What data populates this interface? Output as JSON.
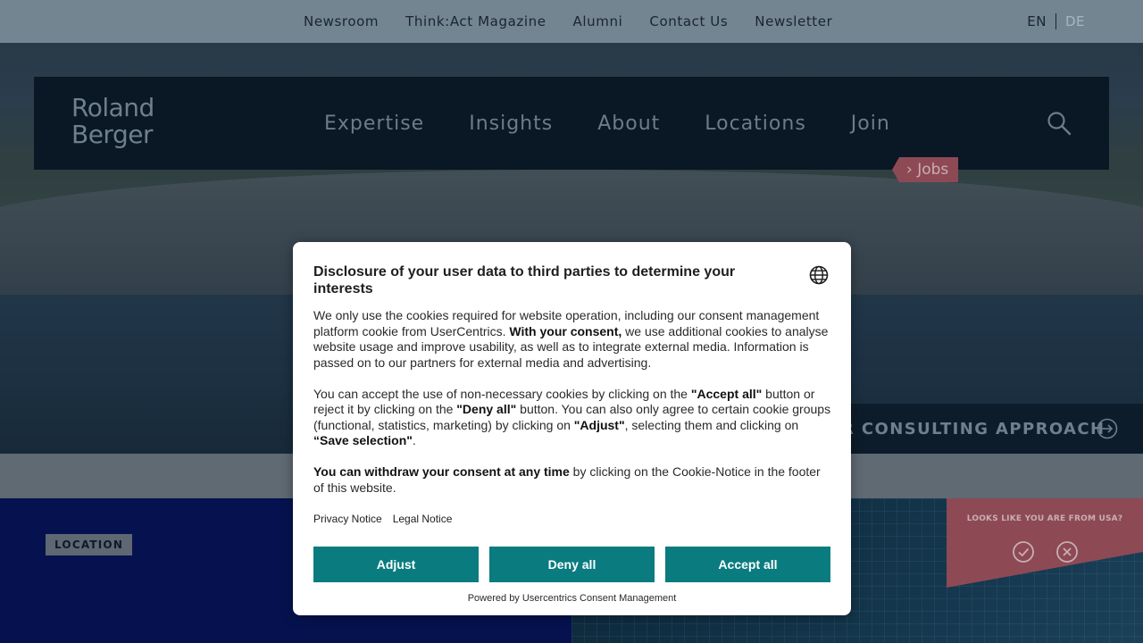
{
  "topbar": {
    "links": [
      "Newsroom",
      "Think:Act Magazine",
      "Alumni",
      "Contact Us",
      "Newsletter"
    ],
    "lang_active": "EN",
    "lang_inactive": "DE"
  },
  "header": {
    "logo_line1": "Roland",
    "logo_line2": "Berger",
    "nav": [
      "Expertise",
      "Insights",
      "About",
      "Locations",
      "Join"
    ],
    "search_icon": "search-icon",
    "jobs_tag": "› Jobs"
  },
  "hero": {
    "cta_label": "R CONSULTING APPROACH",
    "cta_icon": "arrow-circle-icon"
  },
  "sections": {
    "location_badge": "LOCATION",
    "geo_prompt": "LOOKS LIKE YOU ARE FROM USA?",
    "geo_confirm_icon": "check-circle-icon",
    "geo_dismiss_icon": "x-circle-icon"
  },
  "consent": {
    "title": "Disclosure of your user data to third parties to determine your interests",
    "language_icon": "globe-icon",
    "p1_a": "We only use the cookies required for website operation, including our consent management platform cookie from UserCentrics. ",
    "p1_b": "With your consent,",
    "p1_c": " we use additional cookies to analyse website usage and improve usability, as well as to integrate external media. Information is passed on to our partners for external media and advertising.",
    "p2_a": "You can accept the use of non-necessary cookies by clicking on the ",
    "p2_b": "\"Accept all\"",
    "p2_c": " button or reject it by clicking on the ",
    "p2_d": "\"Deny all\"",
    "p2_e": " button. You can also only agree to certain cookie groups (functional, statistics, marketing) by clicking on ",
    "p2_f": "\"Adjust\"",
    "p2_g": ", selecting them and clicking on ",
    "p2_h": "“Save selection\"",
    "p2_i": ".",
    "p3_a": "You can withdraw your consent at any time",
    "p3_b": " by clicking on the Cookie-Notice in the footer of this website.",
    "privacy_link": "Privacy Notice",
    "legal_link": "Legal Notice",
    "btn_adjust": "Adjust",
    "btn_deny": "Deny all",
    "btn_accept": "Accept all",
    "powered_by": "Powered by Usercentrics Consent Management",
    "button_color": "#0a7c80"
  }
}
